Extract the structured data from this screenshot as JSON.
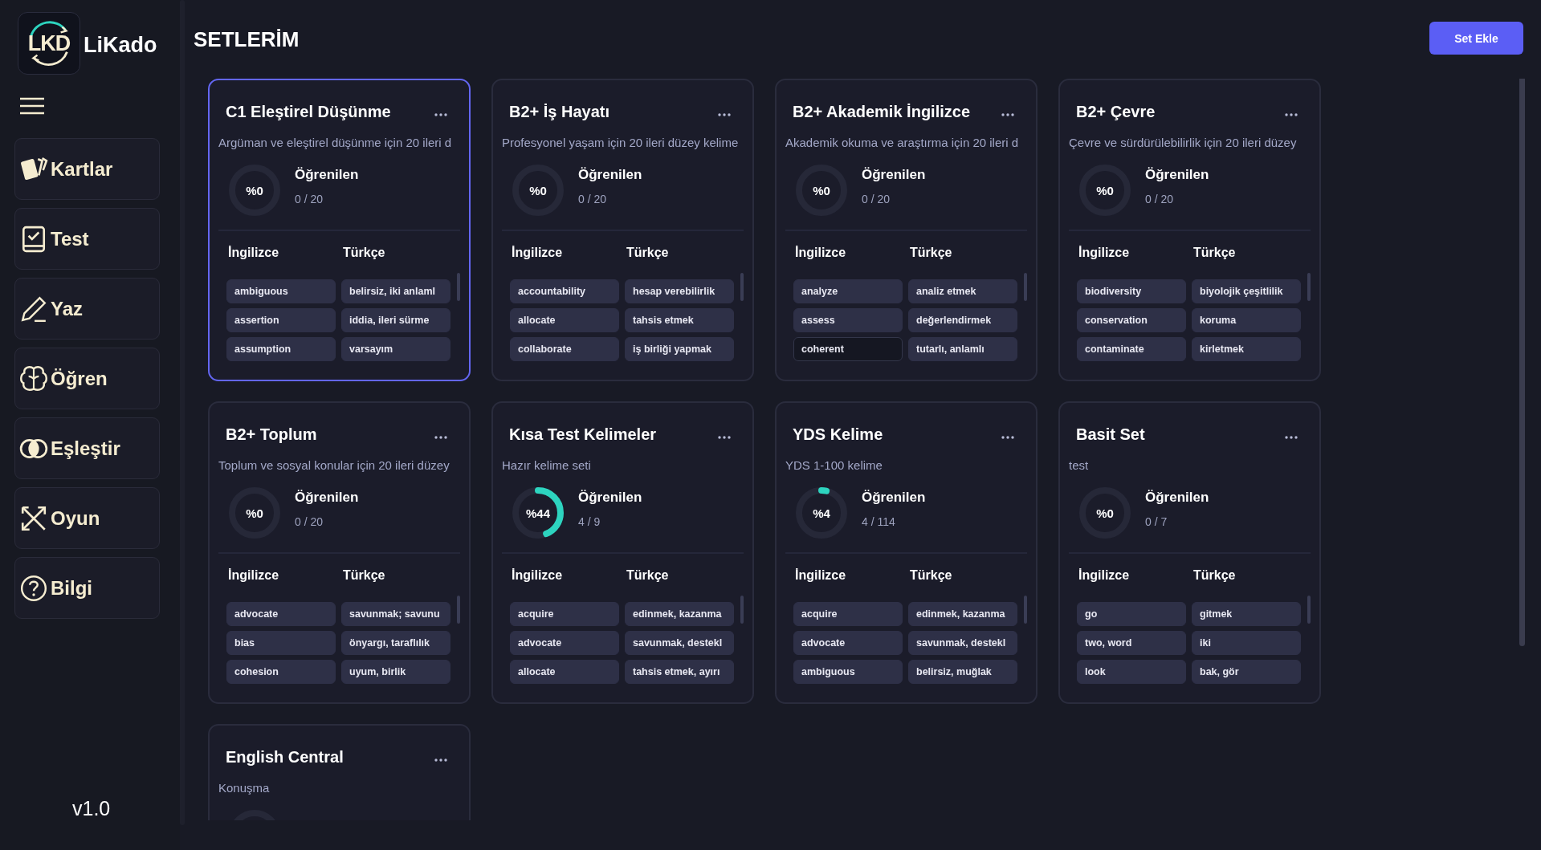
{
  "app": {
    "logo_text": "LKD",
    "name": "LiKado",
    "version": "v1.0"
  },
  "nav": [
    {
      "label": "Kartlar",
      "kind": "cards"
    },
    {
      "label": "Test",
      "kind": "test"
    },
    {
      "label": "Yaz",
      "kind": "write"
    },
    {
      "label": "Öğren",
      "kind": "learn"
    },
    {
      "label": "Eşleştir",
      "kind": "match"
    },
    {
      "label": "Oyun",
      "kind": "game"
    },
    {
      "label": "Bilgi",
      "kind": "info"
    }
  ],
  "page_title": "SETLERİM",
  "add_button": "Set Ekle",
  "cards": [
    {
      "title": "C1 Eleştirel Düşünme",
      "description": "Argüman ve eleştirel düşünme için 20 ileri d",
      "selected": true,
      "level": 0,
      "percent": "%0",
      "progress_label": "Öğrenilen",
      "count": "0 / 20",
      "headers": [
        "İngilizce",
        "Türkçe"
      ],
      "words": [
        {
          "en": "ambiguous",
          "tr": "belirsiz, iki anlaml",
          "hovered": false
        },
        {
          "en": "assertion",
          "tr": "iddia, ileri sürme",
          "hovered": false
        },
        {
          "en": "assumption",
          "tr": "varsayım",
          "hovered": false
        }
      ]
    },
    {
      "title": "B2+ İş Hayatı",
      "description": "Profesyonel yaşam için 20 ileri düzey kelime",
      "selected": false,
      "level": 0,
      "percent": "%0",
      "progress_label": "Öğrenilen",
      "count": "0 / 20",
      "headers": [
        "İngilizce",
        "Türkçe"
      ],
      "words": [
        {
          "en": "accountability",
          "tr": "hesap verebilirlik",
          "hovered": false
        },
        {
          "en": "allocate",
          "tr": "tahsis etmek",
          "hovered": false
        },
        {
          "en": "collaborate",
          "tr": "iş birliği yapmak",
          "hovered": false
        }
      ]
    },
    {
      "title": "B2+ Akademik İngilizce",
      "description": "Akademik okuma ve araştırma için 20 ileri d",
      "selected": false,
      "level": 0,
      "percent": "%0",
      "progress_label": "Öğrenilen",
      "count": "0 / 20",
      "headers": [
        "İngilizce",
        "Türkçe"
      ],
      "words": [
        {
          "en": "analyze",
          "tr": "analiz etmek",
          "hovered": false
        },
        {
          "en": "assess",
          "tr": "değerlendirmek",
          "hovered": false
        },
        {
          "en": "coherent",
          "tr": "tutarlı, anlamlı",
          "hovered": true
        }
      ]
    },
    {
      "title": "B2+ Çevre",
      "description": "Çevre ve sürdürülebilirlik için 20 ileri düzey",
      "selected": false,
      "level": 0,
      "percent": "%0",
      "progress_label": "Öğrenilen",
      "count": "0 / 20",
      "headers": [
        "İngilizce",
        "Türkçe"
      ],
      "words": [
        {
          "en": "biodiversity",
          "tr": "biyolojik çeşitlilik",
          "hovered": false
        },
        {
          "en": "conservation",
          "tr": "koruma",
          "hovered": false
        },
        {
          "en": "contaminate",
          "tr": "kirletmek",
          "hovered": false
        }
      ]
    },
    {
      "title": "B2+ Toplum",
      "description": "Toplum ve sosyal konular için 20 ileri düzey",
      "selected": false,
      "level": 0,
      "percent": "%0",
      "progress_label": "Öğrenilen",
      "count": "0 / 20",
      "headers": [
        "İngilizce",
        "Türkçe"
      ],
      "words": [
        {
          "en": "advocate",
          "tr": "savunmak; savunu",
          "hovered": false
        },
        {
          "en": "bias",
          "tr": "önyargı, taraflılık",
          "hovered": false
        },
        {
          "en": "cohesion",
          "tr": "uyum, birlik",
          "hovered": false
        }
      ]
    },
    {
      "title": "Kısa Test Kelimeler",
      "description": "Hazır kelime seti",
      "selected": false,
      "level": 0.44,
      "percent": "%44",
      "progress_label": "Öğrenilen",
      "count": "4 / 9",
      "headers": [
        "İngilizce",
        "Türkçe"
      ],
      "words": [
        {
          "en": "acquire",
          "tr": "edinmek, kazanma",
          "hovered": false
        },
        {
          "en": "advocate",
          "tr": "savunmak, destekl",
          "hovered": false
        },
        {
          "en": "allocate",
          "tr": "tahsis etmek, ayırı",
          "hovered": false
        }
      ]
    },
    {
      "title": "YDS Kelime",
      "description": "YDS 1-100 kelime",
      "selected": false,
      "level": 0.035,
      "percent": "%4",
      "progress_label": "Öğrenilen",
      "count": "4 / 114",
      "headers": [
        "İngilizce",
        "Türkçe"
      ],
      "words": [
        {
          "en": "acquire",
          "tr": "edinmek, kazanma",
          "hovered": false
        },
        {
          "en": "advocate",
          "tr": "savunmak, destekl",
          "hovered": false
        },
        {
          "en": "ambiguous",
          "tr": "belirsiz, muğlak",
          "hovered": false
        }
      ]
    },
    {
      "title": "Basit Set",
      "description": "test",
      "selected": false,
      "level": 0,
      "percent": "%0",
      "progress_label": "Öğrenilen",
      "count": "0 / 7",
      "headers": [
        "İngilizce",
        "Türkçe"
      ],
      "words": [
        {
          "en": "go",
          "tr": "gitmek",
          "hovered": false
        },
        {
          "en": "two, word",
          "tr": "iki",
          "hovered": false
        },
        {
          "en": "look",
          "tr": "bak, gör",
          "hovered": false
        }
      ]
    },
    {
      "title": "English Central",
      "description": "Konuşma",
      "selected": false,
      "level": 0
    }
  ]
}
